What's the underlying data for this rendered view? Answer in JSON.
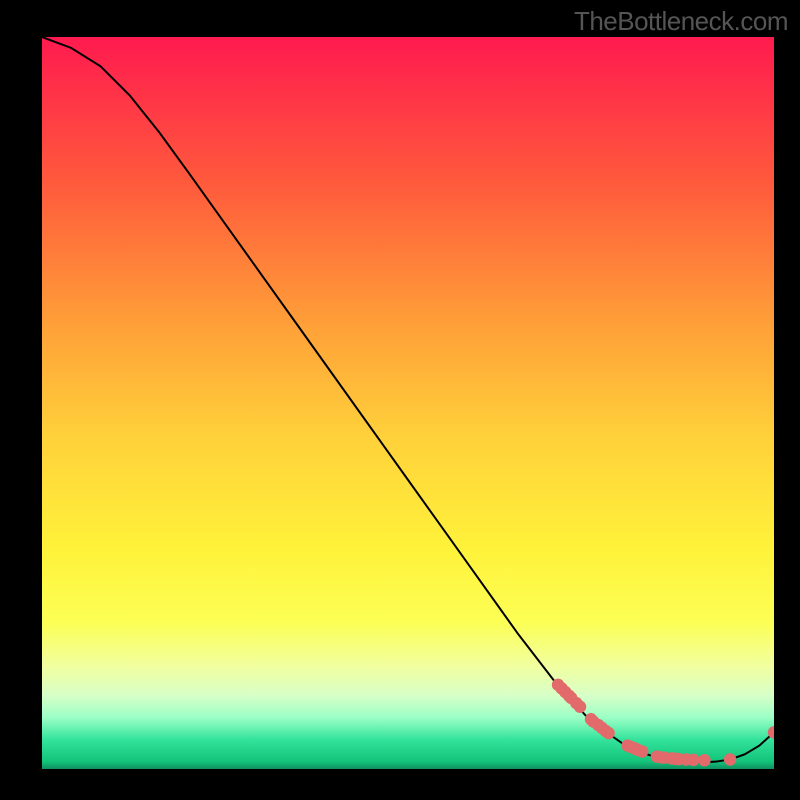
{
  "watermark": "TheBottleneck.com",
  "chart_data": {
    "type": "line",
    "title": "",
    "xlabel": "",
    "ylabel": "",
    "xlim": [
      0,
      100
    ],
    "ylim": [
      0,
      100
    ],
    "grid": false,
    "series": [
      {
        "name": "curve",
        "kind": "line",
        "color": "#000000",
        "x": [
          0,
          4,
          8,
          12,
          16,
          20,
          25,
          30,
          35,
          40,
          45,
          50,
          55,
          60,
          65,
          70,
          75,
          80,
          82,
          84,
          86,
          88,
          90,
          92,
          94,
          96,
          98,
          100
        ],
        "values": [
          100,
          98.5,
          96,
          92,
          87,
          81.5,
          74.5,
          67.5,
          60.5,
          53.5,
          46.5,
          39.5,
          32.5,
          25.5,
          18.5,
          12,
          6.5,
          3,
          2.2,
          1.6,
          1.2,
          1.0,
          0.9,
          1.0,
          1.3,
          2.0,
          3.2,
          5.0
        ]
      },
      {
        "name": "points",
        "kind": "scatter",
        "color": "#e26a6a",
        "x": [
          70.5,
          71,
          71.5,
          72,
          72.3,
          73,
          73.5,
          75,
          75.3,
          76,
          76.5,
          77,
          77.4,
          80,
          80.5,
          81,
          81.4,
          82,
          84,
          84.5,
          85,
          86,
          86.5,
          87,
          88,
          89,
          90.5,
          94,
          100
        ],
        "values": [
          11.5,
          11,
          10.5,
          10,
          9.7,
          9,
          8.5,
          6.8,
          6.5,
          6,
          5.6,
          5.2,
          4.9,
          3.2,
          3,
          2.8,
          2.6,
          2.4,
          1.7,
          1.6,
          1.55,
          1.45,
          1.4,
          1.35,
          1.3,
          1.25,
          1.2,
          1.3,
          5.0
        ]
      }
    ],
    "gradient_stops": [
      {
        "offset": 0,
        "color": "#ff1a4f"
      },
      {
        "offset": 20,
        "color": "#ff5a3c"
      },
      {
        "offset": 40,
        "color": "#ffa238"
      },
      {
        "offset": 55,
        "color": "#ffd23a"
      },
      {
        "offset": 70,
        "color": "#fff23a"
      },
      {
        "offset": 80,
        "color": "#fcff55"
      },
      {
        "offset": 86,
        "color": "#f1ffa0"
      },
      {
        "offset": 90,
        "color": "#d7ffc8"
      },
      {
        "offset": 93,
        "color": "#9affc6"
      },
      {
        "offset": 96,
        "color": "#33e39b"
      },
      {
        "offset": 99,
        "color": "#12c37a"
      },
      {
        "offset": 100,
        "color": "#0f8f5f"
      }
    ]
  }
}
